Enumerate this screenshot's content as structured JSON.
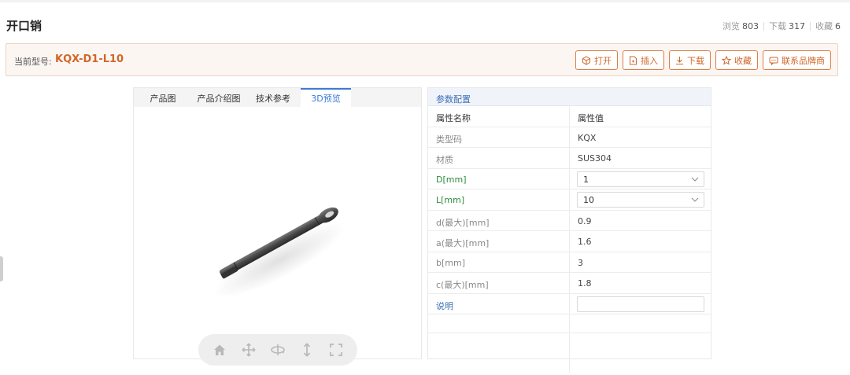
{
  "page": {
    "title": "开口销"
  },
  "stats": [
    {
      "label": "浏览",
      "value": "803"
    },
    {
      "label": "下载",
      "value": "317"
    },
    {
      "label": "收藏",
      "value": "6"
    }
  ],
  "model": {
    "label": "当前型号:",
    "code": "KQX-D1-L10"
  },
  "actions": [
    {
      "icon": "cube-icon",
      "label": "打开"
    },
    {
      "icon": "insert-icon",
      "label": "插入"
    },
    {
      "icon": "download-icon",
      "label": "下载"
    },
    {
      "icon": "star-icon",
      "label": "收藏"
    },
    {
      "icon": "chat-icon",
      "label": "联系品牌商"
    }
  ],
  "tabs": [
    {
      "label": "产品图"
    },
    {
      "label": "产品介绍图"
    },
    {
      "label": "技术参考"
    },
    {
      "label": "3D预览",
      "active": true
    }
  ],
  "viewer_controls": [
    {
      "icon": "home-icon"
    },
    {
      "icon": "pan-icon"
    },
    {
      "icon": "rotate-icon"
    },
    {
      "icon": "vertical-move-icon"
    },
    {
      "icon": "fullscreen-icon"
    }
  ],
  "params": {
    "section_title": "参数配置",
    "header": {
      "name": "属性名称",
      "value": "属性值"
    },
    "rows": [
      {
        "name": "类型码",
        "value": "KQX"
      },
      {
        "name": "材质",
        "value": "SUS304"
      },
      {
        "name": "D[mm]",
        "value": "1",
        "type": "select"
      },
      {
        "name": "L[mm]",
        "value": "10",
        "type": "select"
      },
      {
        "name": "d(最大)[mm]",
        "value": "0.9"
      },
      {
        "name": "a(最大)[mm]",
        "value": "1.6"
      },
      {
        "name": "b[mm]",
        "value": "3"
      },
      {
        "name": "c(最大)[mm]",
        "value": "1.8"
      },
      {
        "name": "说明",
        "value": "",
        "type": "input"
      }
    ]
  },
  "colors": {
    "accent_orange": "#d0672b",
    "tab_active_blue": "#3a7bd5",
    "param_green": "#2e8b3a"
  }
}
